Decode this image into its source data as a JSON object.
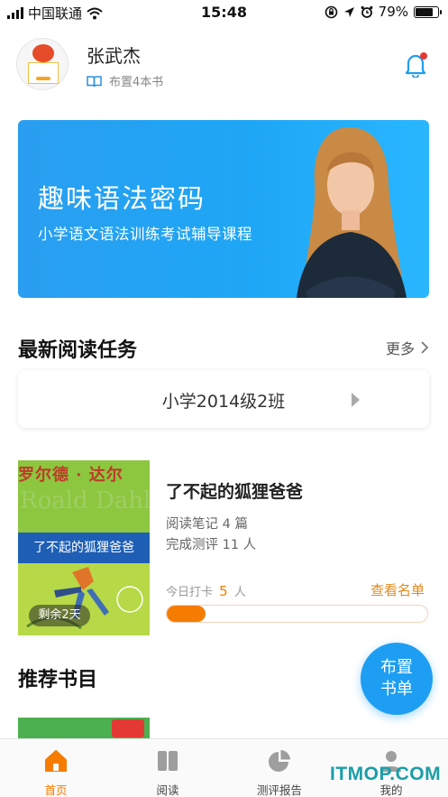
{
  "status_bar": {
    "carrier": "中国联通",
    "time": "15:48",
    "battery": "79%"
  },
  "profile": {
    "name": "张武杰",
    "assigned_books": "布置4本书"
  },
  "banner": {
    "title": "趣味语法密码",
    "subtitle": "小学语文语法训练考试辅导课程"
  },
  "reading_tasks": {
    "title": "最新阅读任务",
    "more": "更多",
    "class_name": "小学2014级2班"
  },
  "book": {
    "cover_author": "罗尔德 · 达尔",
    "cover_author_en": "Roald Dahl",
    "cover_title": "了不起的狐狸爸爸",
    "remaining": "剩余2天",
    "title": "了不起的狐狸爸爸",
    "notes": "阅读笔记 4 篇",
    "evaluations": "完成测评 11 人",
    "checkin_prefix": "今日打卡",
    "checkin_count": "5",
    "checkin_unit": "人",
    "view_list": "查看名单",
    "progress": 0.15
  },
  "recommend": {
    "title": "推荐书目"
  },
  "fab": {
    "line1": "布置",
    "line2": "书单"
  },
  "tabs": [
    {
      "label": "首页",
      "icon": "home-icon"
    },
    {
      "label": "阅读",
      "icon": "book-icon"
    },
    {
      "label": "测评报告",
      "icon": "pie-chart-icon"
    },
    {
      "label": "我的",
      "icon": "user-icon"
    }
  ],
  "watermark": "ITMOP.COM",
  "colors": {
    "accent": "#f57c00",
    "primary_blue": "#1e9ef2",
    "banner_blue": "#2a9ef0"
  }
}
